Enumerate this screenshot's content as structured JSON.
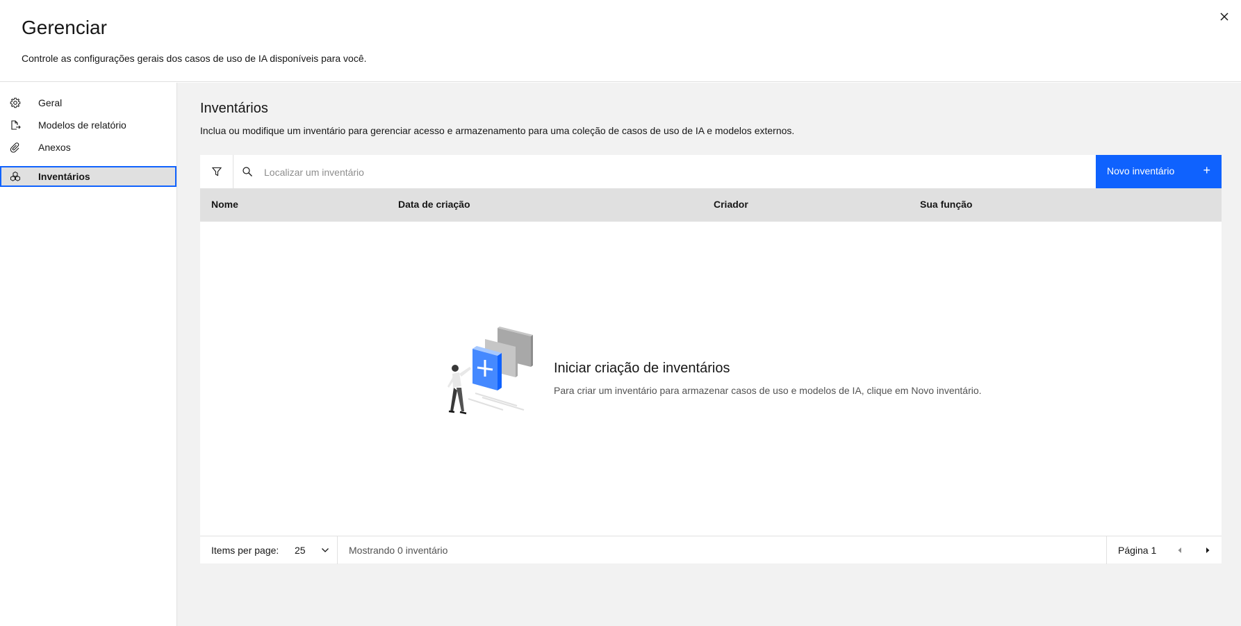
{
  "header": {
    "title": "Gerenciar",
    "subtitle": "Controle as configurações gerais dos casos de uso de IA disponíveis para você.",
    "close_icon": "close-icon"
  },
  "sidebar": {
    "items": [
      {
        "label": "Geral",
        "icon": "gear-icon"
      },
      {
        "label": "Modelos de relatório",
        "icon": "document-export-icon"
      },
      {
        "label": "Anexos",
        "icon": "paperclip-icon"
      },
      {
        "label": "Inventários",
        "icon": "inventory-icon",
        "active": true
      }
    ]
  },
  "main": {
    "title": "Inventários",
    "description": "Inclua ou modifique um inventário para gerenciar acesso e armazenamento para uma coleção de casos de uso de IA e modelos externos.",
    "search": {
      "placeholder": "Localizar um inventário",
      "value": ""
    },
    "new_button": {
      "label": "Novo inventário",
      "icon": "plus-icon"
    },
    "table": {
      "columns": [
        "Nome",
        "Data de criação",
        "Criador",
        "Sua função"
      ],
      "rows": []
    },
    "empty_state": {
      "title": "Iniciar criação de inventários",
      "text": "Para criar um inventário para armazenar casos de uso e modelos de IA, clique em Novo inventário."
    },
    "pagination": {
      "items_per_page_label": "Items per page:",
      "items_per_page_value": "25",
      "showing": "Mostrando 0 inventário",
      "page_label": "Página 1"
    }
  },
  "colors": {
    "accent": "#0f62fe",
    "background": "#f2f2f2",
    "table_header": "#e0e0e0"
  }
}
